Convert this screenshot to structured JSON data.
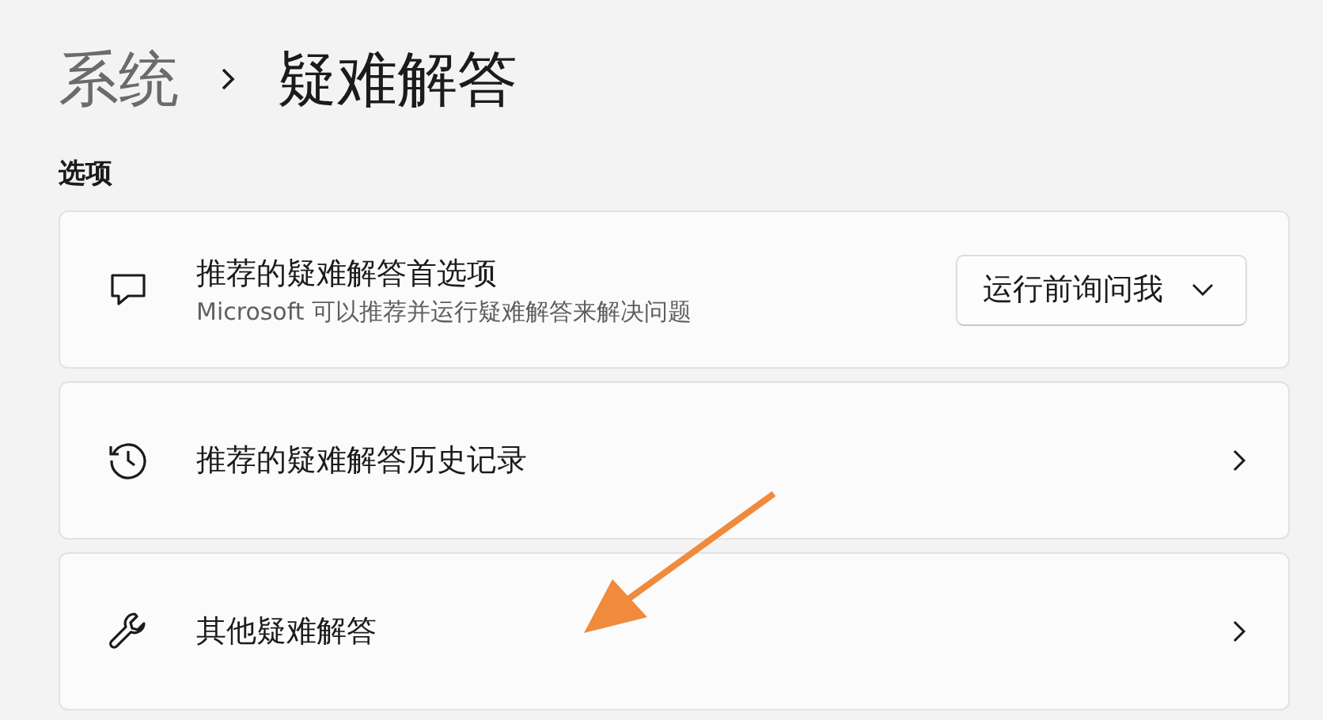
{
  "breadcrumb": {
    "parent": "系统",
    "current": "疑难解答"
  },
  "section_title": "选项",
  "settings": [
    {
      "kind": "dropdown",
      "title": "推荐的疑难解答首选项",
      "description": "Microsoft 可以推荐并运行疑难解答来解决问题",
      "value": "运行前询问我"
    },
    {
      "kind": "link",
      "title": "推荐的疑难解答历史记录"
    },
    {
      "kind": "link",
      "title": "其他疑难解答"
    }
  ]
}
